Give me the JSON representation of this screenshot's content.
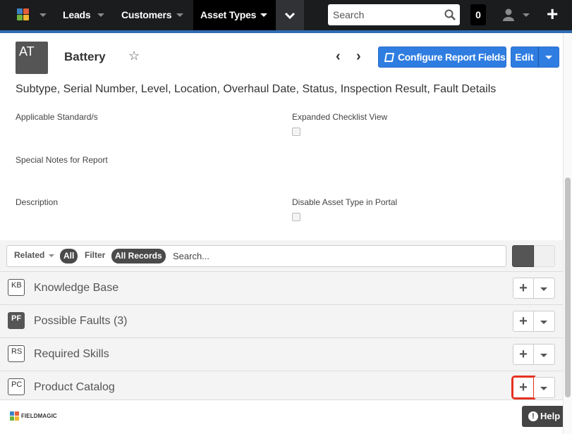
{
  "navbar": {
    "nav_items": [
      "Leads",
      "Customers",
      "Asset Types"
    ],
    "search_placeholder": "Search",
    "notification_count": "0",
    "colors": {
      "bar": "#1b1c1e",
      "accent": "#2f6db5"
    }
  },
  "record": {
    "avatar": "AT",
    "title": "Battery",
    "configure_label": "Configure Report Fields",
    "edit_label": "Edit",
    "report_fields": "Subtype, Serial Number, Level, Location, Overhaul Date, Status, Inspection Result, Fault Details"
  },
  "fields": {
    "applicable_standards": "Applicable Standard/s",
    "expanded_checklist": "Expanded Checklist View",
    "special_notes": "Special Notes for Report",
    "description": "Description",
    "disable_asset_type": "Disable Asset Type in Portal"
  },
  "related": {
    "related_label": "Related",
    "all_pill": "All",
    "filter_label": "Filter",
    "all_records_pill": "All Records",
    "search_placeholder": "Search...",
    "items": [
      {
        "badge": "KB",
        "title": "Knowledge Base",
        "filled": false
      },
      {
        "badge": "PF",
        "title": "Possible Faults (3)",
        "filled": true
      },
      {
        "badge": "RS",
        "title": "Required Skills",
        "filled": false
      },
      {
        "badge": "PC",
        "title": "Product Catalog",
        "filled": false
      }
    ]
  },
  "footer": {
    "brand": "FIELDMAGIC",
    "help_label": "Help"
  }
}
